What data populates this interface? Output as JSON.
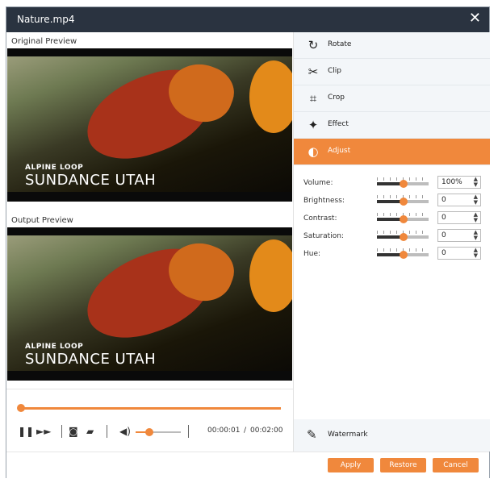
{
  "window": {
    "title": "Nature.mp4",
    "close_icon": "close-icon"
  },
  "preview": {
    "original_label": "Original Preview",
    "output_label": "Output Preview",
    "video_caption_small": "ALPINE LOOP",
    "video_caption_large": "SUNDANCE UTAH"
  },
  "controls": {
    "progress": 0.0,
    "volume": 0.3,
    "current_time": "00:00:01",
    "separator": "/",
    "total_time": "00:02:00"
  },
  "menu": {
    "items": [
      {
        "label": "Rotate",
        "icon": "rotate-icon",
        "glyph": "↻"
      },
      {
        "label": "Clip",
        "icon": "scissors-icon",
        "glyph": "✂"
      },
      {
        "label": "Crop",
        "icon": "crop-icon",
        "glyph": "⌗"
      },
      {
        "label": "Effect",
        "icon": "effect-icon",
        "glyph": "✦"
      },
      {
        "label": "Adjust",
        "icon": "adjust-icon",
        "glyph": "◐"
      }
    ],
    "active": "Adjust",
    "watermark": {
      "label": "Watermark",
      "icon": "brush-icon",
      "glyph": "✎"
    }
  },
  "adjust": [
    {
      "label": "Volume:",
      "value": "100%"
    },
    {
      "label": "Brightness:",
      "value": "0"
    },
    {
      "label": "Contrast:",
      "value": "0"
    },
    {
      "label": "Saturation:",
      "value": "0"
    },
    {
      "label": "Hue:",
      "value": "0"
    }
  ],
  "footer": {
    "apply_label": "Apply",
    "restore_label": "Restore",
    "cancel_label": "Cancel"
  },
  "colors": {
    "accent": "#f0883c",
    "titlebar": "#2a3340"
  }
}
